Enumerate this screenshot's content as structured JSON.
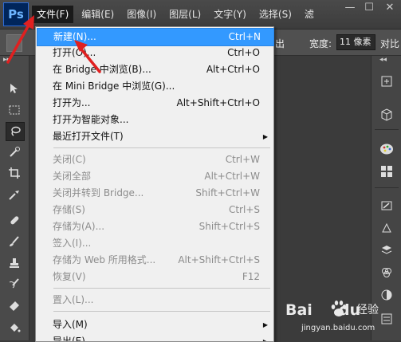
{
  "app": {
    "logo": "Ps"
  },
  "menubar": {
    "items": [
      "文件(F)",
      "编辑(E)",
      "图像(I)",
      "图层(L)",
      "文字(Y)",
      "选择(S)",
      "滤"
    ],
    "window_controls": [
      "—",
      "☐",
      "✕"
    ]
  },
  "options_bar": {
    "partial_text": "出",
    "width_label": "宽度:",
    "width_value": "11 像素",
    "contrast_partial": "对比"
  },
  "file_menu": {
    "items": [
      {
        "label": "新建(N)...",
        "shortcut": "Ctrl+N",
        "state": "highlighted"
      },
      {
        "label": "打开(O)...",
        "shortcut": "Ctrl+O",
        "state": "enabled"
      },
      {
        "label": "在 Bridge 中浏览(B)...",
        "shortcut": "Alt+Ctrl+O",
        "state": "enabled"
      },
      {
        "label": "在 Mini Bridge 中浏览(G)...",
        "shortcut": "",
        "state": "enabled"
      },
      {
        "label": "打开为...",
        "shortcut": "Alt+Shift+Ctrl+O",
        "state": "enabled"
      },
      {
        "label": "打开为智能对象...",
        "shortcut": "",
        "state": "enabled"
      },
      {
        "label": "最近打开文件(T)",
        "shortcut": "",
        "state": "submenu"
      },
      {
        "label": "关闭(C)",
        "shortcut": "Ctrl+W",
        "state": "disabled"
      },
      {
        "label": "关闭全部",
        "shortcut": "Alt+Ctrl+W",
        "state": "disabled"
      },
      {
        "label": "关闭并转到 Bridge...",
        "shortcut": "Shift+Ctrl+W",
        "state": "disabled"
      },
      {
        "label": "存储(S)",
        "shortcut": "Ctrl+S",
        "state": "disabled"
      },
      {
        "label": "存储为(A)...",
        "shortcut": "Shift+Ctrl+S",
        "state": "disabled"
      },
      {
        "label": "签入(I)...",
        "shortcut": "",
        "state": "disabled"
      },
      {
        "label": "存储为 Web 所用格式...",
        "shortcut": "Alt+Shift+Ctrl+S",
        "state": "disabled"
      },
      {
        "label": "恢复(V)",
        "shortcut": "F12",
        "state": "disabled"
      },
      {
        "label": "置入(L)...",
        "shortcut": "",
        "state": "disabled"
      },
      {
        "label": "导入(M)",
        "shortcut": "",
        "state": "submenu"
      },
      {
        "label": "导出(E)",
        "shortcut": "",
        "state": "submenu"
      }
    ]
  },
  "watermark": {
    "brand": "Bai",
    "brand_suffix": "du",
    "cn": "经验",
    "url": "jingyan.baidu.com"
  },
  "colors": {
    "highlight": "#3399ff",
    "annotation": "#e02020",
    "logo_bg": "#00255b",
    "logo_text": "#6fb6ff"
  }
}
